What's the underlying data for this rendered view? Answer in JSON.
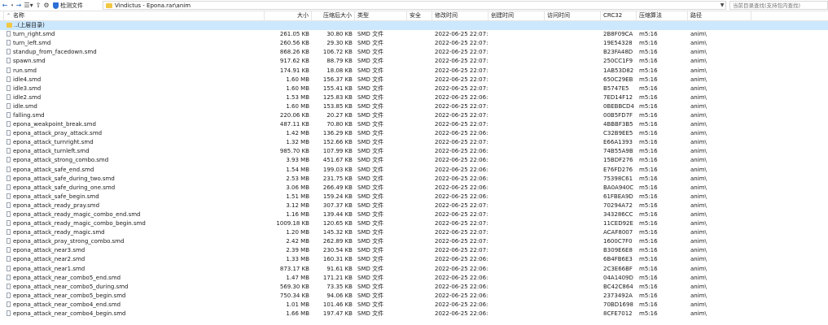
{
  "toolbar": {
    "back_icon": "back-arrow-icon",
    "check_label": "检测文件",
    "view_icon": "list-view-icon",
    "address": "Vindictus - Epona.rar\\anim",
    "search_placeholder": "当前目录查找(支持包内查找)"
  },
  "columns": {
    "name": "名称",
    "size": "大小",
    "packed": "压缩后大小",
    "type": "类型",
    "security": "安全",
    "modified": "修改时间",
    "created": "创建时间",
    "accessed": "访问时间",
    "crc": "CRC32",
    "algorithm": "压缩算法",
    "path": "路径"
  },
  "up_row": {
    "name": "..(上层目录)"
  },
  "files": [
    {
      "name": "turn_right.smd",
      "size": "261.05 KB",
      "packed": "30.80 KB",
      "type": "SMD 文件",
      "modified": "2022-06-25 22:07:...",
      "crc": "2B8F09CA",
      "alg": "m5:16",
      "path": "anim\\"
    },
    {
      "name": "turn_left.smd",
      "size": "260.56 KB",
      "packed": "29.30 KB",
      "type": "SMD 文件",
      "modified": "2022-06-25 22:07:...",
      "crc": "19E54328",
      "alg": "m5:16",
      "path": "anim\\"
    },
    {
      "name": "standup_from_facedown.smd",
      "size": "868.26 KB",
      "packed": "106.72 KB",
      "type": "SMD 文件",
      "modified": "2022-06-25 22:07:...",
      "crc": "B23FA48D",
      "alg": "m5:16",
      "path": "anim\\"
    },
    {
      "name": "spawn.smd",
      "size": "917.62 KB",
      "packed": "88.79 KB",
      "type": "SMD 文件",
      "modified": "2022-06-25 22:07:...",
      "crc": "250CC1F9",
      "alg": "m5:16",
      "path": "anim\\"
    },
    {
      "name": "run.smd",
      "size": "174.91 KB",
      "packed": "18.08 KB",
      "type": "SMD 文件",
      "modified": "2022-06-25 22:07:...",
      "crc": "1AB53D82",
      "alg": "m5:16",
      "path": "anim\\"
    },
    {
      "name": "idle4.smd",
      "size": "1.60 MB",
      "packed": "156.37 KB",
      "type": "SMD 文件",
      "modified": "2022-06-25 22:07:...",
      "crc": "650C29EB",
      "alg": "m5:16",
      "path": "anim\\"
    },
    {
      "name": "idle3.smd",
      "size": "1.60 MB",
      "packed": "155.41 KB",
      "type": "SMD 文件",
      "modified": "2022-06-25 22:07:...",
      "crc": "B5747E5",
      "alg": "m5:16",
      "path": "anim\\"
    },
    {
      "name": "idle2.smd",
      "size": "1.53 MB",
      "packed": "125.83 KB",
      "type": "SMD 文件",
      "modified": "2022-06-25 22:06:...",
      "crc": "7ED14F12",
      "alg": "m5:16",
      "path": "anim\\"
    },
    {
      "name": "idle.smd",
      "size": "1.60 MB",
      "packed": "153.85 KB",
      "type": "SMD 文件",
      "modified": "2022-06-25 22:07:...",
      "crc": "0BEBBCD4",
      "alg": "m5:16",
      "path": "anim\\"
    },
    {
      "name": "falling.smd",
      "size": "220.06 KB",
      "packed": "20.27 KB",
      "type": "SMD 文件",
      "modified": "2022-06-25 22:07:...",
      "crc": "00B5FD7F",
      "alg": "m5:16",
      "path": "anim\\"
    },
    {
      "name": "epona_weakpoint_break.smd",
      "size": "487.11 KB",
      "packed": "70.80 KB",
      "type": "SMD 文件",
      "modified": "2022-06-25 22:07:...",
      "crc": "4BBBF3B5",
      "alg": "m5:16",
      "path": "anim\\"
    },
    {
      "name": "epona_attack_pray_attack.smd",
      "size": "1.42 MB",
      "packed": "136.29 KB",
      "type": "SMD 文件",
      "modified": "2022-06-25 22:06:...",
      "crc": "C32B9EE5",
      "alg": "m5:16",
      "path": "anim\\"
    },
    {
      "name": "epona_attack_turnright.smd",
      "size": "1.32 MB",
      "packed": "152.66 KB",
      "type": "SMD 文件",
      "modified": "2022-06-25 22:07:...",
      "crc": "E66A1393",
      "alg": "m5:16",
      "path": "anim\\"
    },
    {
      "name": "epona_attack_turnleft.smd",
      "size": "985.70 KB",
      "packed": "107.99 KB",
      "type": "SMD 文件",
      "modified": "2022-06-25 22:06:...",
      "crc": "74B55A9B",
      "alg": "m5:16",
      "path": "anim\\"
    },
    {
      "name": "epona_attack_strong_combo.smd",
      "size": "3.93 MB",
      "packed": "451.67 KB",
      "type": "SMD 文件",
      "modified": "2022-06-25 22:06:...",
      "crc": "15BDF276",
      "alg": "m5:16",
      "path": "anim\\"
    },
    {
      "name": "epona_attack_safe_end.smd",
      "size": "1.54 MB",
      "packed": "199.03 KB",
      "type": "SMD 文件",
      "modified": "2022-06-25 22:06:...",
      "crc": "E76FD276",
      "alg": "m5:16",
      "path": "anim\\"
    },
    {
      "name": "epona_attack_safe_during_two.smd",
      "size": "2.53 MB",
      "packed": "231.75 KB",
      "type": "SMD 文件",
      "modified": "2022-06-25 22:06:...",
      "crc": "75398C61",
      "alg": "m5:16",
      "path": "anim\\"
    },
    {
      "name": "epona_attack_safe_during_one.smd",
      "size": "3.06 MB",
      "packed": "266.49 KB",
      "type": "SMD 文件",
      "modified": "2022-06-25 22:06:...",
      "crc": "BA0A940C",
      "alg": "m5:16",
      "path": "anim\\"
    },
    {
      "name": "epona_attack_safe_begin.smd",
      "size": "1.51 MB",
      "packed": "159.24 KB",
      "type": "SMD 文件",
      "modified": "2022-06-25 22:06:...",
      "crc": "61FBEA9D",
      "alg": "m5:16",
      "path": "anim\\"
    },
    {
      "name": "epona_attack_ready_pray.smd",
      "size": "3.12 MB",
      "packed": "307.37 KB",
      "type": "SMD 文件",
      "modified": "2022-06-25 22:07:...",
      "crc": "70294A72",
      "alg": "m5:16",
      "path": "anim\\"
    },
    {
      "name": "epona_attack_ready_magic_combo_end.smd",
      "size": "1.16 MB",
      "packed": "139.44 KB",
      "type": "SMD 文件",
      "modified": "2022-06-25 22:07:...",
      "crc": "343286CC",
      "alg": "m5:16",
      "path": "anim\\"
    },
    {
      "name": "epona_attack_ready_magic_combo_begin.smd",
      "size": "1009.18 KB",
      "packed": "120.65 KB",
      "type": "SMD 文件",
      "modified": "2022-06-25 22:07:...",
      "crc": "11CED92E",
      "alg": "m5:16",
      "path": "anim\\"
    },
    {
      "name": "epona_attack_ready_magic.smd",
      "size": "1.20 MB",
      "packed": "145.32 KB",
      "type": "SMD 文件",
      "modified": "2022-06-25 22:07:...",
      "crc": "ACAF8007",
      "alg": "m5:16",
      "path": "anim\\"
    },
    {
      "name": "epona_attack_pray_strong_combo.smd",
      "size": "2.42 MB",
      "packed": "262.89 KB",
      "type": "SMD 文件",
      "modified": "2022-06-25 22:07:...",
      "crc": "1600C7F0",
      "alg": "m5:16",
      "path": "anim\\"
    },
    {
      "name": "epona_attack_near3.smd",
      "size": "2.39 MB",
      "packed": "230.54 KB",
      "type": "SMD 文件",
      "modified": "2022-06-25 22:07:...",
      "crc": "B309E6E8",
      "alg": "m5:16",
      "path": "anim\\"
    },
    {
      "name": "epona_attack_near2.smd",
      "size": "1.33 MB",
      "packed": "160.31 KB",
      "type": "SMD 文件",
      "modified": "2022-06-25 22:06:...",
      "crc": "6B4FB6E3",
      "alg": "m5:16",
      "path": "anim\\"
    },
    {
      "name": "epona_attack_near1.smd",
      "size": "873.17 KB",
      "packed": "91.61 KB",
      "type": "SMD 文件",
      "modified": "2022-06-25 22:06:...",
      "crc": "2C3E66BF",
      "alg": "m5:16",
      "path": "anim\\"
    },
    {
      "name": "epona_attack_near_combo5_end.smd",
      "size": "1.47 MB",
      "packed": "171.21 KB",
      "type": "SMD 文件",
      "modified": "2022-06-25 22:06:...",
      "crc": "04A1409D",
      "alg": "m5:16",
      "path": "anim\\"
    },
    {
      "name": "epona_attack_near_combo5_during.smd",
      "size": "569.30 KB",
      "packed": "73.35 KB",
      "type": "SMD 文件",
      "modified": "2022-06-25 22:06:...",
      "crc": "BC42C864",
      "alg": "m5:16",
      "path": "anim\\"
    },
    {
      "name": "epona_attack_near_combo5_begin.smd",
      "size": "750.34 KB",
      "packed": "94.06 KB",
      "type": "SMD 文件",
      "modified": "2022-06-25 22:06:...",
      "crc": "2373492A",
      "alg": "m5:16",
      "path": "anim\\"
    },
    {
      "name": "epona_attack_near_combo4_end.smd",
      "size": "1.01 MB",
      "packed": "101.46 KB",
      "type": "SMD 文件",
      "modified": "2022-06-25 22:06:...",
      "crc": "70BD1698",
      "alg": "m5:16",
      "path": "anim\\"
    },
    {
      "name": "epona_attack_near_combo4_begin.smd",
      "size": "1.66 MB",
      "packed": "197.47 KB",
      "type": "SMD 文件",
      "modified": "2022-06-25 22:06:...",
      "crc": "8CFE7012",
      "alg": "m5:16",
      "path": "anim\\"
    }
  ]
}
